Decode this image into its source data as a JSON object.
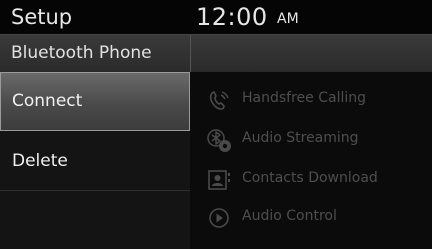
{
  "status_bar": {
    "title": "Setup",
    "time": "12:00",
    "ampm": "AM"
  },
  "header": {
    "title": "Bluetooth Phone"
  },
  "menu": {
    "items": [
      {
        "label": "Connect",
        "selected": true
      },
      {
        "label": "Delete",
        "selected": false
      }
    ]
  },
  "features": [
    {
      "label": "Handsfree Calling",
      "icon": "handsfree-phone-icon"
    },
    {
      "label": "Audio Streaming",
      "icon": "bluetooth-audio-icon"
    },
    {
      "label": "Contacts Download",
      "icon": "contacts-download-icon"
    },
    {
      "label": "Audio Control",
      "icon": "play-circle-icon"
    }
  ],
  "colors": {
    "background": "#0a0a0a",
    "text": "#e6e6e6",
    "disabled_text": "#4e4e4e",
    "selected_item": "#5a5a5a"
  }
}
